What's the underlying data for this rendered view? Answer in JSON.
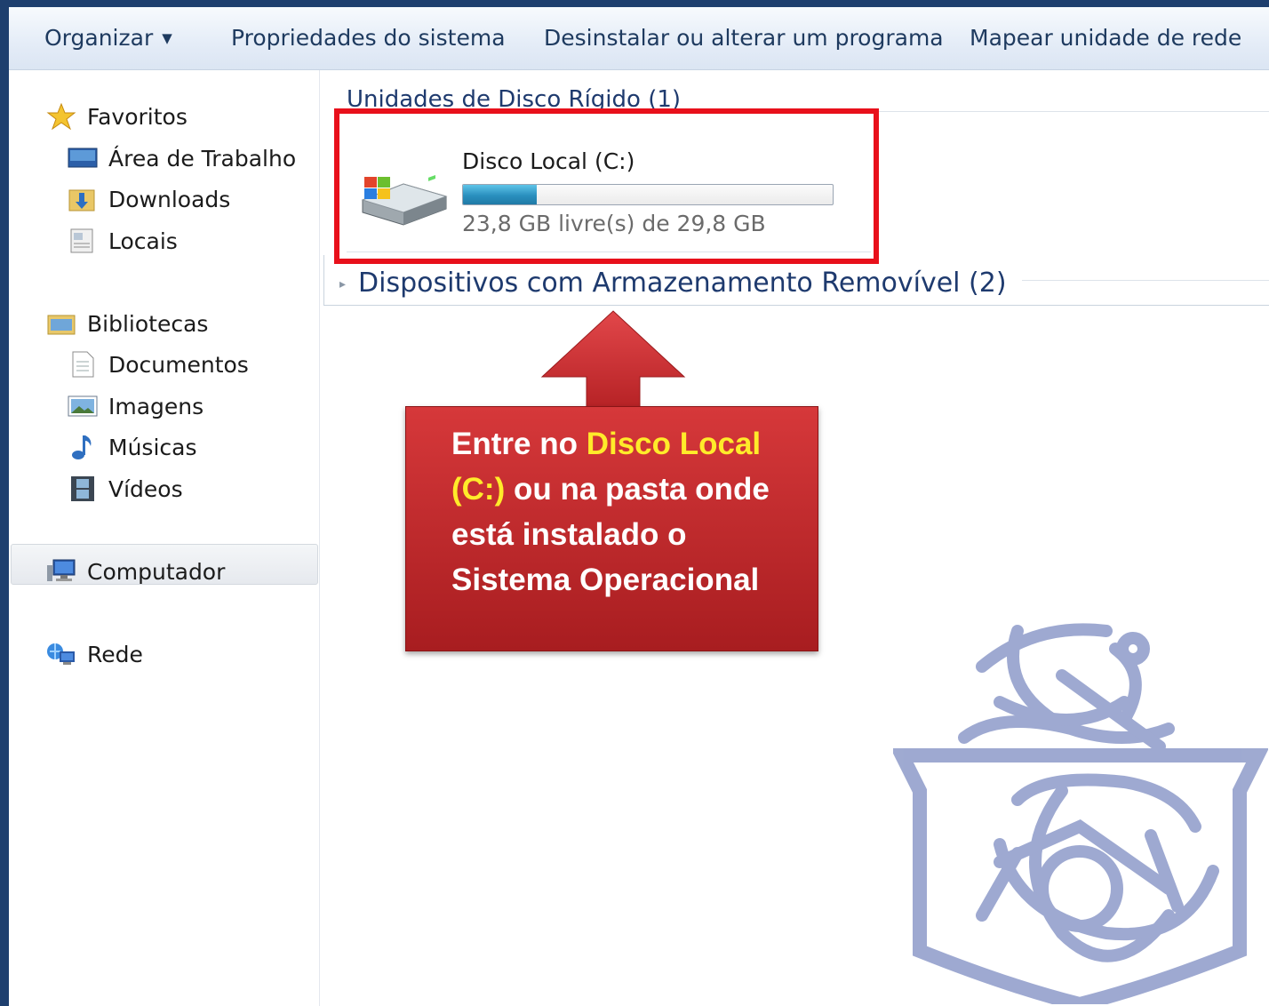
{
  "toolbar": {
    "organize": "Organizar",
    "system_properties": "Propriedades do sistema",
    "uninstall": "Desinstalar ou alterar um programa",
    "map_drive": "Mapear unidade de rede"
  },
  "nav": {
    "favorites": "Favoritos",
    "desktop": "Área de Trabalho",
    "downloads": "Downloads",
    "places": "Locais",
    "libraries": "Bibliotecas",
    "documents": "Documentos",
    "images": "Imagens",
    "music": "Músicas",
    "videos": "Vídeos",
    "computer": "Computador",
    "network": "Rede"
  },
  "content": {
    "hard_disks_header": "Unidades de Disco Rígido (1)",
    "drive_name": "Disco Local (C:)",
    "drive_used_fraction": 0.2,
    "drive_free_text": "23,8 GB livre(s) de 29,8 GB",
    "removable_header": "Dispositivos com Armazenamento Removível (2)"
  },
  "callout": {
    "part1": "Entre no ",
    "highlight": "Disco Local (C:)",
    "part2": " ou na pasta onde está instalado o Sistema Operacional"
  },
  "colors": {
    "highlight_border": "#e8101b",
    "callout_bg": "#c0282b",
    "callout_highlight_text": "#ffeb2a",
    "background": "#1e3f6e"
  }
}
